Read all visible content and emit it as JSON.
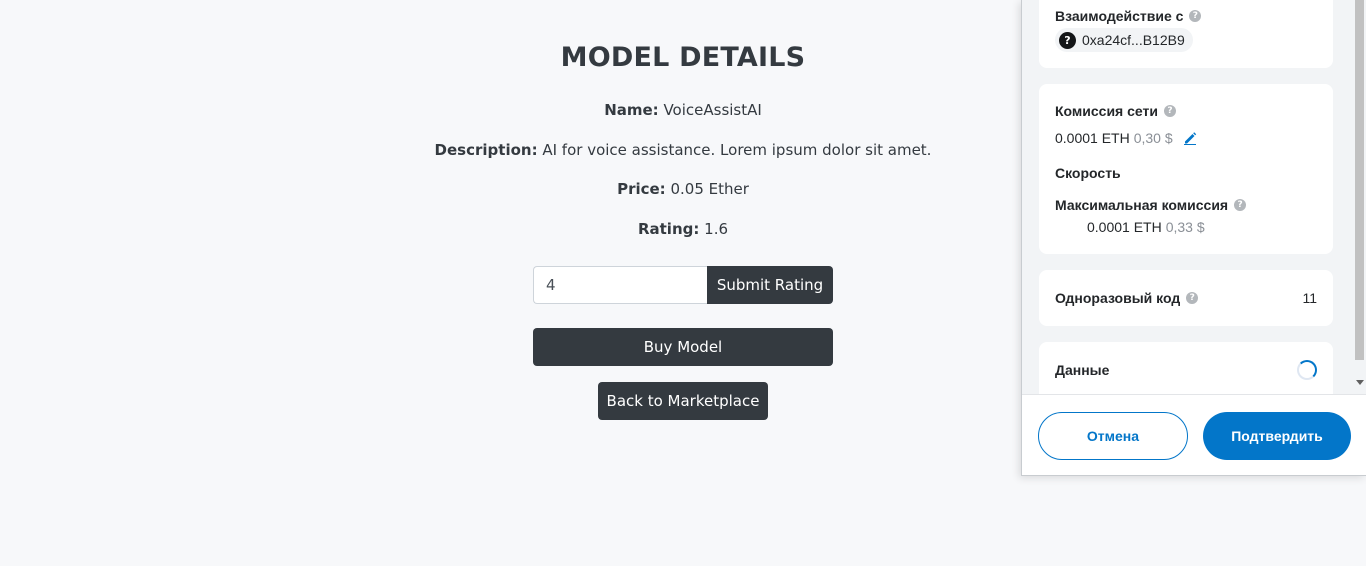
{
  "model": {
    "title": "MODEL DETAILS",
    "name_label": "Name:",
    "name_value": "VoiceAssistAI",
    "description_label": "Description:",
    "description_value": "AI for voice assistance. Lorem ipsum dolor sit amet.",
    "price_label": "Price:",
    "price_value": "0.05 Ether",
    "rating_label": "Rating:",
    "rating_value": "1.6",
    "rating_input_value": "4",
    "submit_rating_label": "Submit Rating",
    "buy_label": "Buy Model",
    "back_label": "Back to Marketplace"
  },
  "wallet": {
    "interact_label": "Взаимодействие с",
    "address": "0xa24cf...B12B9",
    "fee_label": "Комиссия сети",
    "fee_eth": "0.0001 ETH",
    "fee_fiat": "0,30 $",
    "speed_label": "Скорость",
    "max_fee_label": "Максимальная комиссия",
    "max_fee_eth": "0.0001 ETH",
    "max_fee_fiat": "0,33 $",
    "nonce_label": "Одноразовый код",
    "nonce_value": "11",
    "data_label": "Данные",
    "cancel_label": "Отмена",
    "confirm_label": "Подтвердить",
    "help_glyph": "?",
    "colors": {
      "accent": "#0376c9",
      "background": "#f2f4f6"
    },
    "icons": [
      "help-icon",
      "address-identicon",
      "edit-icon",
      "loading-spinner"
    ]
  }
}
